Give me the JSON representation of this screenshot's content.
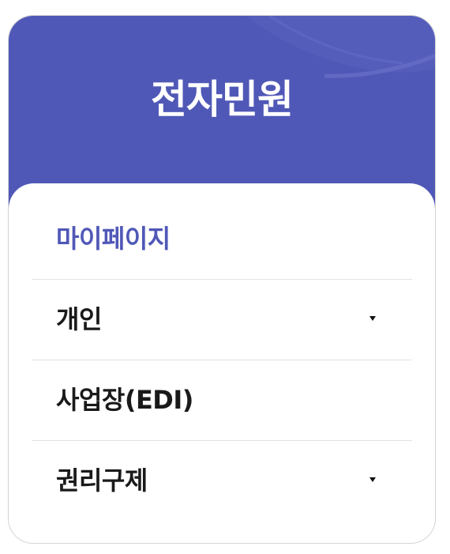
{
  "header": {
    "title": "전자민원"
  },
  "menu": {
    "items": [
      {
        "label": "마이페이지",
        "active": true,
        "has_submenu": false
      },
      {
        "label": "개인",
        "active": false,
        "has_submenu": true,
        "icon": "caret-down-icon"
      },
      {
        "label": "사업장(EDI)",
        "active": false,
        "has_submenu": false
      },
      {
        "label": "권리구제",
        "active": false,
        "has_submenu": true,
        "icon": "caret-down-icon"
      }
    ]
  },
  "colors": {
    "accent": "#5058b7",
    "text": "#1a1a1a",
    "divider": "#e2e2e2",
    "header_text": "#ffffff"
  }
}
